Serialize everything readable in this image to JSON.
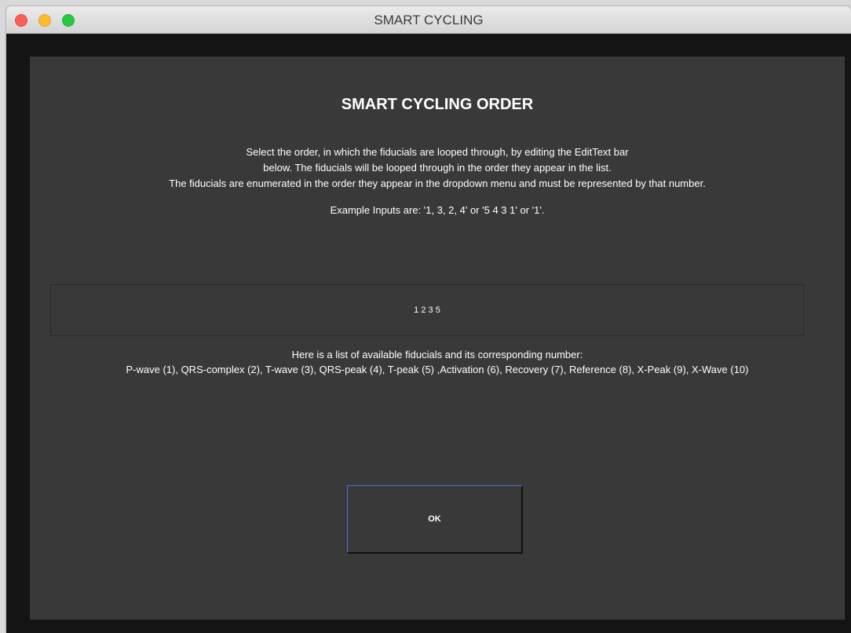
{
  "window": {
    "title": "SMART CYCLING"
  },
  "dialog": {
    "heading": "SMART CYCLING ORDER",
    "instructions": [
      "Select the order, in which the fiducials are looped through, by editing the EditText bar",
      "below. The fiducials will be looped through in the order they appear in the list.",
      "The fiducials are enumerated in the order they appear in the dropdown menu and must be represented by that number."
    ],
    "example": "Example Inputs are: '1, 3, 2, 4' or '5 4 3 1' or '1'.",
    "order_input_value": "1 2 3 5",
    "list_intro": "Here is a list of available fiducials and its corresponding number:",
    "fiducials_line": "P-wave (1), QRS-complex (2), T-wave (3), QRS-peak (4), T-peak (5) ,Activation (6), Recovery  (7), Reference (8), X-Peak (9), X-Wave (10)",
    "ok_label": "OK"
  },
  "colors": {
    "panel_bg": "#393939",
    "window_bg": "#141414",
    "text": "#ffffff",
    "button_focus": "#4a6fd8"
  }
}
